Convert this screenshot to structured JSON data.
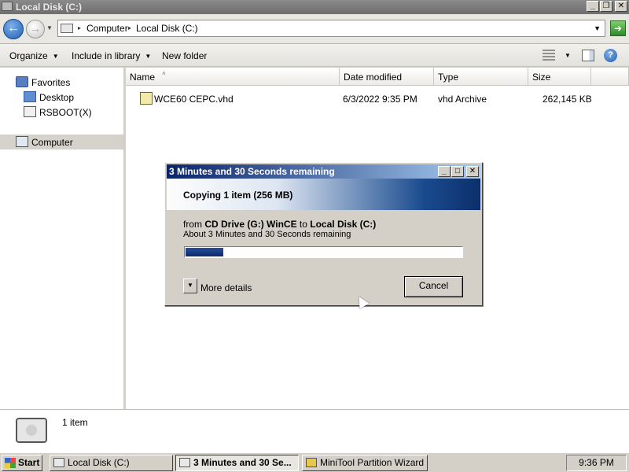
{
  "window": {
    "title": "Local Disk (C:)",
    "buttons": [
      "_",
      "❐",
      "✕"
    ]
  },
  "address": {
    "back_icon": "back-arrow-icon",
    "crumbs": [
      "Computer",
      "Local Disk (C:)"
    ],
    "go_icon": "go-arrow-icon"
  },
  "toolbar": {
    "organize": "Organize",
    "include_in_library": "Include in library",
    "new_folder": "New folder"
  },
  "nav": {
    "favorites": "Favorites",
    "desktop": "Desktop",
    "rsboot": "RSBOOT(X)",
    "computer": "Computer"
  },
  "columns": {
    "name": "Name",
    "date_modified": "Date modified",
    "type": "Type",
    "size": "Size"
  },
  "files": [
    {
      "name": "WCE60 CEPC.vhd",
      "date": "6/3/2022 9:35 PM",
      "type": "vhd Archive",
      "size": "262,145 KB"
    }
  ],
  "details": {
    "count": "1 item"
  },
  "dialog": {
    "title": "3 Minutes and 30 Seconds remaining",
    "buttons": [
      "_",
      "□",
      "✕"
    ],
    "heading": "Copying 1 item (256 MB)",
    "from_prefix": "from ",
    "source": "CD Drive (G:) WinCE",
    "to_word": " to ",
    "destination": "Local Disk (C:)",
    "remaining": "About 3 Minutes and 30 Seconds remaining",
    "progress_fraction": 0.135,
    "more_details": "More details",
    "cancel": "Cancel"
  },
  "taskbar": {
    "start": "Start",
    "tasks": [
      {
        "label": "Local Disk (C:)",
        "active": false
      },
      {
        "label": "3 Minutes and 30 Se...",
        "active": true
      },
      {
        "label": "MiniTool Partition Wizard ...",
        "active": false
      }
    ],
    "clock": "9:36 PM"
  }
}
